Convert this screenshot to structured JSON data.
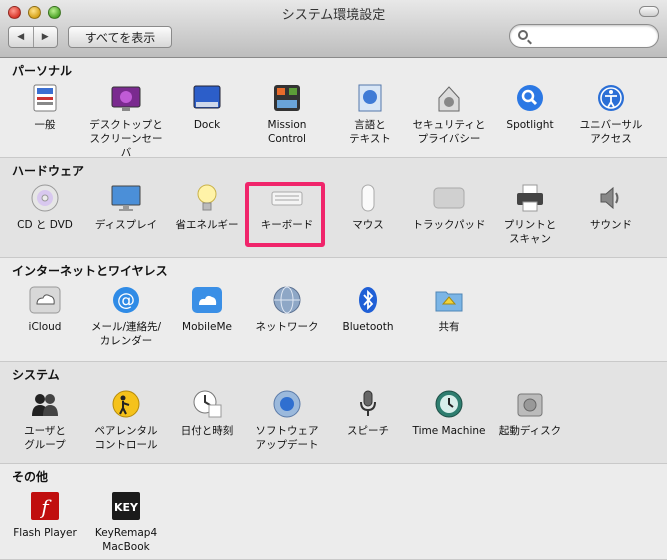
{
  "window": {
    "title": "システム環境設定"
  },
  "toolbar": {
    "back": "◀",
    "forward": "▶",
    "show_all": "すべてを表示",
    "search_value": ""
  },
  "sections": [
    {
      "title": "パーソナル",
      "items": [
        {
          "label": "一般",
          "icon": "general-icon"
        },
        {
          "label": "デスクトップと\nスクリーンセーバ",
          "icon": "desktop-icon"
        },
        {
          "label": "Dock",
          "icon": "dock-icon"
        },
        {
          "label": "Mission\nControl",
          "icon": "mission-control-icon"
        },
        {
          "label": "言語と\nテキスト",
          "icon": "language-icon"
        },
        {
          "label": "セキュリティと\nプライバシー",
          "icon": "security-icon"
        },
        {
          "label": "Spotlight",
          "icon": "spotlight-icon"
        },
        {
          "label": "ユニバーサル\nアクセス",
          "icon": "universal-access-icon"
        }
      ]
    },
    {
      "title": "ハードウェア",
      "items": [
        {
          "label": "CD と DVD",
          "icon": "cd-dvd-icon"
        },
        {
          "label": "ディスプレイ",
          "icon": "display-icon"
        },
        {
          "label": "省エネルギー",
          "icon": "energy-saver-icon"
        },
        {
          "label": "キーボード",
          "icon": "keyboard-icon"
        },
        {
          "label": "マウス",
          "icon": "mouse-icon"
        },
        {
          "label": "トラックパッド",
          "icon": "trackpad-icon"
        },
        {
          "label": "プリントと\nスキャン",
          "icon": "printer-icon"
        },
        {
          "label": "サウンド",
          "icon": "sound-icon"
        }
      ]
    },
    {
      "title": "インターネットとワイヤレス",
      "items": [
        {
          "label": "iCloud",
          "icon": "icloud-icon"
        },
        {
          "label": "メール/連絡先/\nカレンダー",
          "icon": "mail-icon"
        },
        {
          "label": "MobileMe",
          "icon": "mobileme-icon"
        },
        {
          "label": "ネットワーク",
          "icon": "network-icon"
        },
        {
          "label": "Bluetooth",
          "icon": "bluetooth-icon"
        },
        {
          "label": "共有",
          "icon": "sharing-icon"
        }
      ]
    },
    {
      "title": "システム",
      "items": [
        {
          "label": "ユーザと\nグループ",
          "icon": "users-icon"
        },
        {
          "label": "ペアレンタル\nコントロール",
          "icon": "parental-controls-icon"
        },
        {
          "label": "日付と時刻",
          "icon": "date-time-icon"
        },
        {
          "label": "ソフトウェア\nアップデート",
          "icon": "software-update-icon"
        },
        {
          "label": "スピーチ",
          "icon": "speech-icon"
        },
        {
          "label": "Time Machine",
          "icon": "time-machine-icon"
        },
        {
          "label": "起動ディスク",
          "icon": "startup-disk-icon"
        }
      ]
    },
    {
      "title": "その他",
      "items": [
        {
          "label": "Flash Player",
          "icon": "flash-player-icon"
        },
        {
          "label": "KeyRemap4\nMacBook",
          "icon": "keyremap-icon"
        }
      ]
    }
  ],
  "highlight": {
    "section": 1,
    "item": 3,
    "color": "#f0256b"
  }
}
